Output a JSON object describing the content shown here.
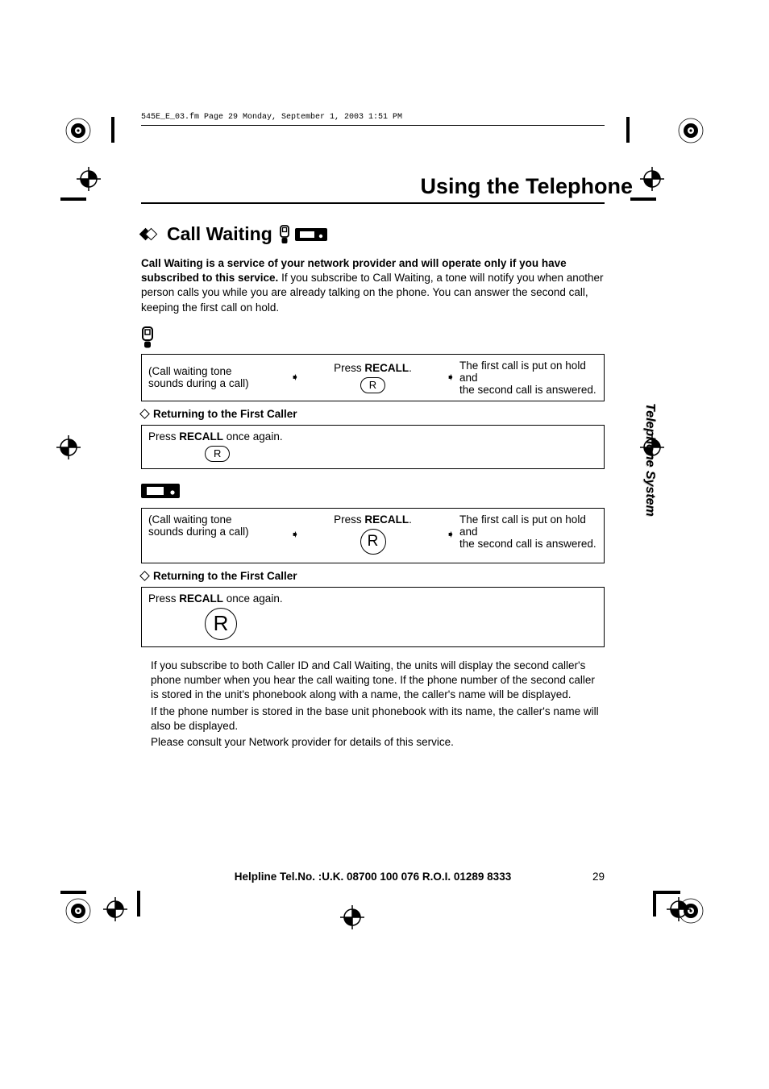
{
  "header_line": "545E_E_03.fm  Page 29  Monday, September 1, 2003  1:51 PM",
  "doc_title": "Using the Telephone",
  "section_title": "Call Waiting",
  "intro": {
    "bold": "Call Waiting is a service of your network provider and will operate only if you have subscribed to this service.",
    "rest": " If you subscribe to Call Waiting, a tone will notify you when another person calls you while you are already talking on the phone. You can answer the second call, keeping the first call on hold."
  },
  "steps": {
    "col1_l1": "(Call waiting tone",
    "col1_l2": "sounds during a call)",
    "col2_prefix": "Press ",
    "col2_bold": "RECALL",
    "col2_suffix": ".",
    "key_r": "R",
    "col3_l1": "The first call is put on hold and",
    "col3_l2": "the second call is answered."
  },
  "subheading": "Returning to the First Caller",
  "return_box": {
    "prefix": "Press ",
    "bold": "RECALL",
    "suffix": " once again.",
    "key": "R"
  },
  "notes": {
    "p1": "If you subscribe to both Caller ID and Call Waiting, the units will display the second caller's phone number when you hear the call waiting tone. If the phone number of the second caller is stored in the unit's phonebook along with a name, the caller's name will be displayed.",
    "p2": "If the phone number is stored in the base unit phonebook with its name, the caller's name will also be displayed.",
    "p3": "Please consult your Network provider for details of this service."
  },
  "side_tab": "Telephone System",
  "footer": {
    "helpline": "Helpline Tel.No. :U.K. 08700 100 076  R.O.I. 01289 8333",
    "page": "29"
  }
}
